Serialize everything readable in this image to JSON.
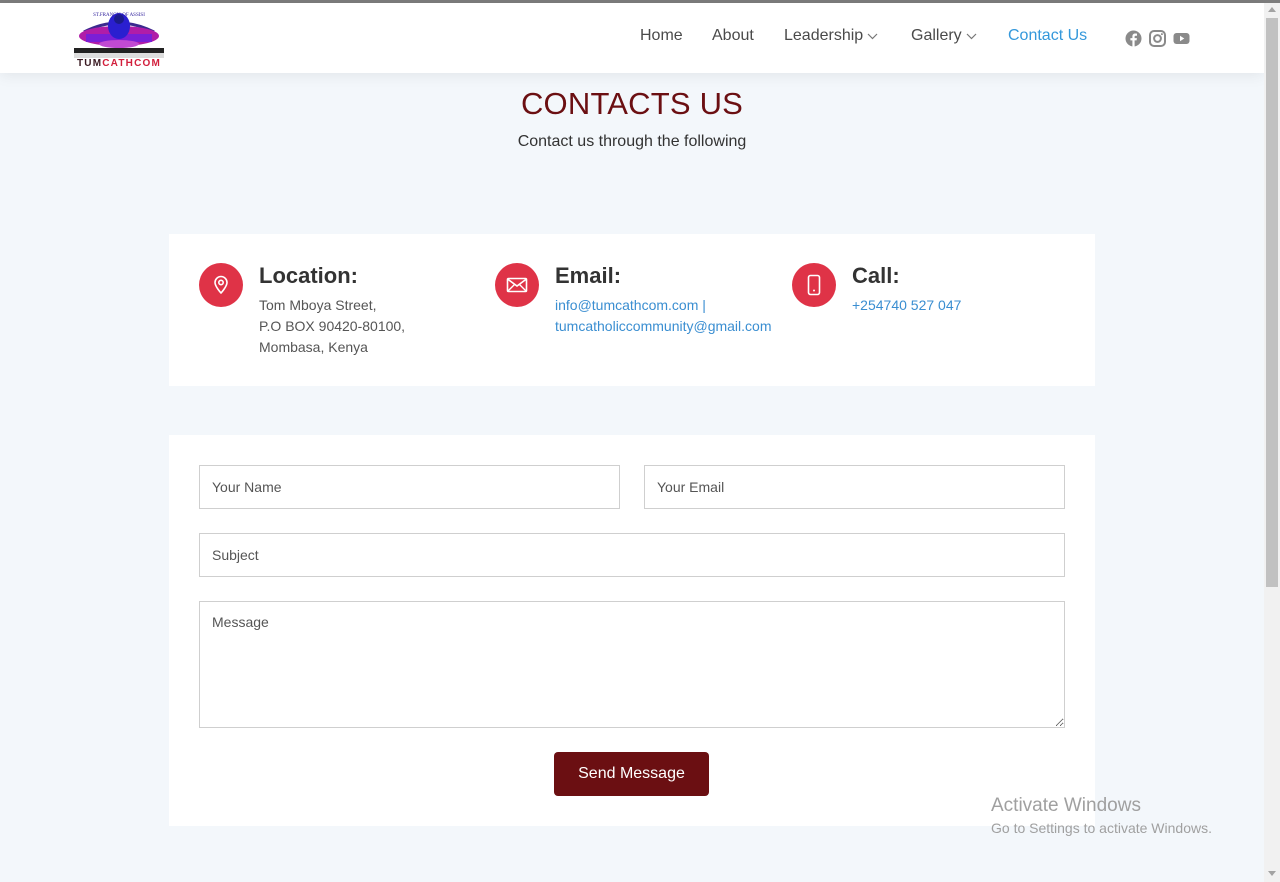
{
  "brand": {
    "logo_text_dark": "TUM",
    "logo_text_accent": "CATHCOM"
  },
  "nav": {
    "home": "Home",
    "about": "About",
    "leadership": "Leadership",
    "gallery": "Gallery",
    "contact": "Contact Us",
    "social": [
      "facebook-icon",
      "instagram-icon",
      "youtube-icon"
    ]
  },
  "page": {
    "title": "CONTACTS US",
    "subtitle": "Contact us through the following"
  },
  "contact_info": {
    "location": {
      "heading": "Location:",
      "line1": "Tom Mboya Street,",
      "line2": "P.O BOX 90420-80100,",
      "line3": "Mombasa, Kenya",
      "icon": "map-pin-icon"
    },
    "email": {
      "heading": "Email:",
      "line1": "info@tumcathcom.com |",
      "line2": "tumcatholiccommunity@gmail.com",
      "icon": "envelope-icon"
    },
    "call": {
      "heading": "Call:",
      "line1": "+254740 527 047",
      "icon": "phone-icon"
    }
  },
  "form": {
    "name_placeholder": "Your Name",
    "email_placeholder": "Your Email",
    "subject_placeholder": "Subject",
    "message_placeholder": "Message",
    "submit_label": "Send Message"
  },
  "watermark": {
    "title": "Activate Windows",
    "subtitle": "Go to Settings to activate Windows."
  },
  "colors": {
    "accent": "#6b0f12",
    "icon_circle": "#df3347",
    "link": "#3a8ed1",
    "nav_active": "#3498db",
    "background": "#f3f7fb"
  }
}
